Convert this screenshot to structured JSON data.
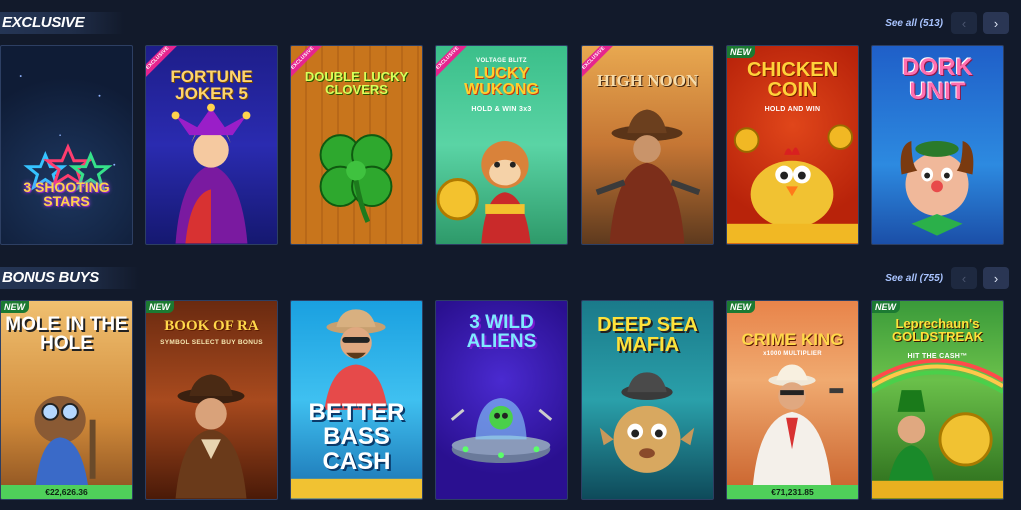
{
  "sections": [
    {
      "title": "EXCLUSIVE",
      "see_all": "See all (513)",
      "games": [
        {
          "title": "3 SHOOTING STARS",
          "badge": ""
        },
        {
          "title": "FORTUNE JOKER 5",
          "badge": "EXCLUSIVE"
        },
        {
          "title": "DOUBLE LUCKY CLOVERS",
          "badge": "EXCLUSIVE"
        },
        {
          "title": "LUCKY WUKONG",
          "supertitle": "VOLTAGE BLITZ",
          "subtitle": "HOLD & WIN 3x3",
          "badge": "EXCLUSIVE"
        },
        {
          "title": "HIGH NOON",
          "badge": "EXCLUSIVE"
        },
        {
          "title": "CHICKEN COIN",
          "subtitle": "HOLD AND WIN",
          "badge": "NEW"
        },
        {
          "title": "DORK UNIT",
          "badge": ""
        }
      ]
    },
    {
      "title": "BONUS BUYS",
      "see_all": "See all (755)",
      "games": [
        {
          "title": "MOLE IN THE HOLE",
          "badge": "NEW",
          "jackpot": "€22,626.36"
        },
        {
          "title": "BOOK OF RA",
          "subtitle": "SYMBOL SELECT BUY BONUS",
          "badge": "NEW"
        },
        {
          "title": "BETTER BASS CASH",
          "badge": ""
        },
        {
          "title": "3 WILD ALIENS",
          "badge": ""
        },
        {
          "title": "DEEP SEA MAFIA",
          "badge": ""
        },
        {
          "title": "CRIME KING",
          "subtitle": "x1000 MULTIPLIER",
          "badge": "NEW",
          "jackpot": "€71,231.85"
        },
        {
          "title": "Leprechaun's GOLDSTREAK",
          "subtitle": "HIT THE CASH™",
          "badge": "NEW"
        }
      ]
    }
  ],
  "nav": {
    "prev": "‹",
    "next": "›"
  },
  "colors": {
    "background": "#121a2b",
    "see_all": "#a9c4ff",
    "exclusive_ribbon": "#e6258f",
    "new_tag": "#1c7a32",
    "jackpot_bar": "#4fd05a"
  }
}
